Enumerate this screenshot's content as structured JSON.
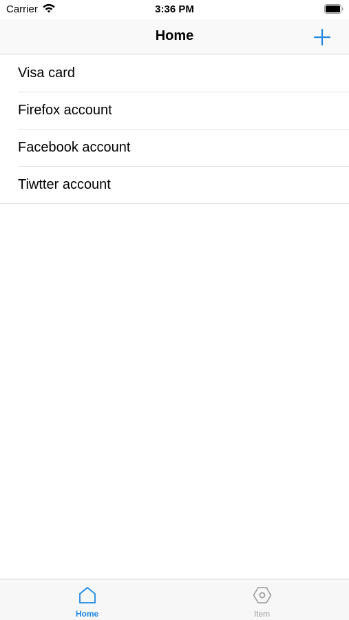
{
  "status_bar": {
    "carrier": "Carrier",
    "time": "3:36 PM",
    "icons": [
      "wifi-icon",
      "battery-icon"
    ]
  },
  "nav": {
    "title": "Home",
    "add_icon": "plus-icon"
  },
  "items": [
    {
      "label": "Visa card"
    },
    {
      "label": "Firefox account"
    },
    {
      "label": "Facebook account"
    },
    {
      "label": "Tiwtter account"
    }
  ],
  "tabs": [
    {
      "label": "Home",
      "icon": "home-icon",
      "active": true
    },
    {
      "label": "Item",
      "icon": "hexagon-icon",
      "active": false
    }
  ],
  "colors": {
    "accent": "#1e88e5",
    "inactive": "#9a9a9a"
  }
}
